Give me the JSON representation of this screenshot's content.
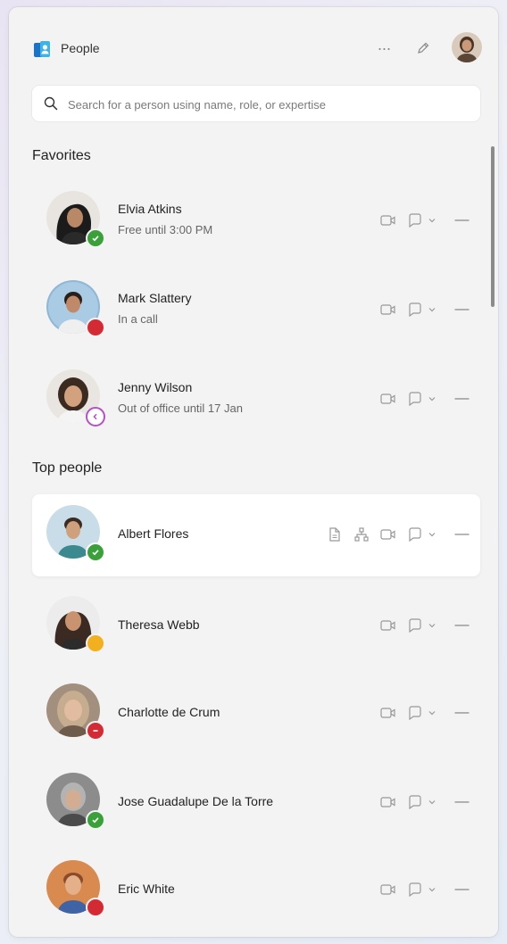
{
  "app": {
    "title": "People"
  },
  "search": {
    "placeholder": "Search for a person using name, role, or expertise"
  },
  "sections": {
    "favorites": "Favorites",
    "top_people": "Top people"
  },
  "colors": {
    "available": "#3aa13a",
    "busy": "#d42a33",
    "away": "#f2b01e",
    "out_of_office": "#b650c8",
    "accent": "#1a73c8"
  },
  "favorites": [
    {
      "name": "Elvia Atkins",
      "status": "Free until 3:00 PM",
      "presence": "available",
      "icon": "avatar-photo"
    },
    {
      "name": "Mark Slattery",
      "status": "In a call",
      "presence": "busy",
      "icon": "avatar-photo"
    },
    {
      "name": "Jenny Wilson",
      "status": "Out of office until 17 Jan",
      "presence": "out_of_office",
      "icon": "avatar-photo"
    }
  ],
  "top_people": [
    {
      "name": "Albert Flores",
      "presence": "available",
      "hovered": true
    },
    {
      "name": "Theresa Webb",
      "presence": "away"
    },
    {
      "name": "Charlotte de Crum",
      "presence": "busy"
    },
    {
      "name": "Jose Guadalupe De la Torre",
      "presence": "available"
    },
    {
      "name": "Eric White",
      "presence": "busy"
    }
  ],
  "icons": {
    "app": "people-app-icon",
    "more": "more-icon",
    "edit": "edit-icon",
    "search": "search-icon",
    "video": "video-call-icon",
    "chat": "chat-icon",
    "chevron": "chevron-down-icon",
    "file": "file-icon",
    "org": "org-chart-icon"
  }
}
